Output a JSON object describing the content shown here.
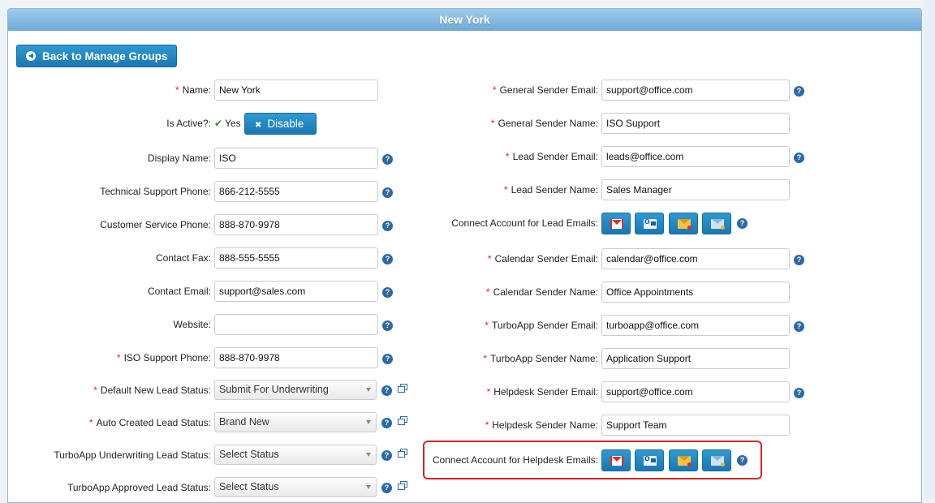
{
  "header": {
    "title": "New York"
  },
  "back_button": {
    "label": "Back to Manage Groups"
  },
  "left": {
    "name": {
      "label": "Name:",
      "value": "New York",
      "required": "*"
    },
    "is_active": {
      "label": "Is Active?:",
      "value": "Yes",
      "button": "Disable"
    },
    "display_name": {
      "label": "Display Name:",
      "value": "ISO"
    },
    "tech_phone": {
      "label": "Technical Support Phone:",
      "value": "866-212-5555"
    },
    "cust_phone": {
      "label": "Customer Service Phone:",
      "value": "888-870-9978"
    },
    "fax": {
      "label": "Contact Fax:",
      "value": "888-555-5555"
    },
    "email": {
      "label": "Contact Email:",
      "value": "support@sales.com"
    },
    "website": {
      "label": "Website:",
      "value": ""
    },
    "iso_phone": {
      "label": "ISO Support Phone:",
      "value": "888-870-9978",
      "required": "*"
    },
    "default_status": {
      "label": "Default New Lead Status:",
      "value": "Submit For Underwriting",
      "required": "*"
    },
    "auto_status": {
      "label": "Auto Created Lead Status:",
      "value": "Brand New",
      "required": "*"
    },
    "turbo_uw_status": {
      "label": "TurboApp Underwriting Lead Status:",
      "value": "Select Status"
    },
    "turbo_appr_status": {
      "label": "TurboApp Approved Lead Status:",
      "value": "Select Status"
    }
  },
  "right": {
    "general_email": {
      "label": "General Sender Email:",
      "value": "support@office.com",
      "required": "*"
    },
    "general_name": {
      "label": "General Sender Name:",
      "value": "ISO Support",
      "required": "*"
    },
    "lead_email": {
      "label": "Lead Sender Email:",
      "value": "leads@office.com",
      "required": "*"
    },
    "lead_name": {
      "label": "Lead Sender Name:",
      "value": "Sales Manager",
      "required": "*"
    },
    "connect_lead": {
      "label": "Connect Account for Lead Emails:"
    },
    "calendar_email": {
      "label": "Calendar Sender Email:",
      "value": "calendar@office.com",
      "required": "*"
    },
    "calendar_name": {
      "label": "Calendar Sender Name:",
      "value": "Office Appointments",
      "required": "*"
    },
    "turbo_email": {
      "label": "TurboApp Sender Email:",
      "value": "turboapp@office.com",
      "required": "*"
    },
    "turbo_name": {
      "label": "TurboApp Sender Name:",
      "value": "Application Support",
      "required": "*"
    },
    "helpdesk_email": {
      "label": "Helpdesk Sender Email:",
      "value": "support@office.com",
      "required": "*"
    },
    "helpdesk_name": {
      "label": "Helpdesk Sender Name:",
      "value": "Support Team",
      "required": "*"
    },
    "connect_helpdesk": {
      "label": "Connect Account for Helpdesk Emails:"
    }
  },
  "icons": {
    "help": "?",
    "providers": [
      "gmail-icon",
      "outlook-icon",
      "imap-icon",
      "smtp-icon"
    ]
  },
  "colors": {
    "accent": "#1a77b2",
    "header": "#7fb6e0",
    "required": "#d22222",
    "highlight": "#e02020"
  }
}
